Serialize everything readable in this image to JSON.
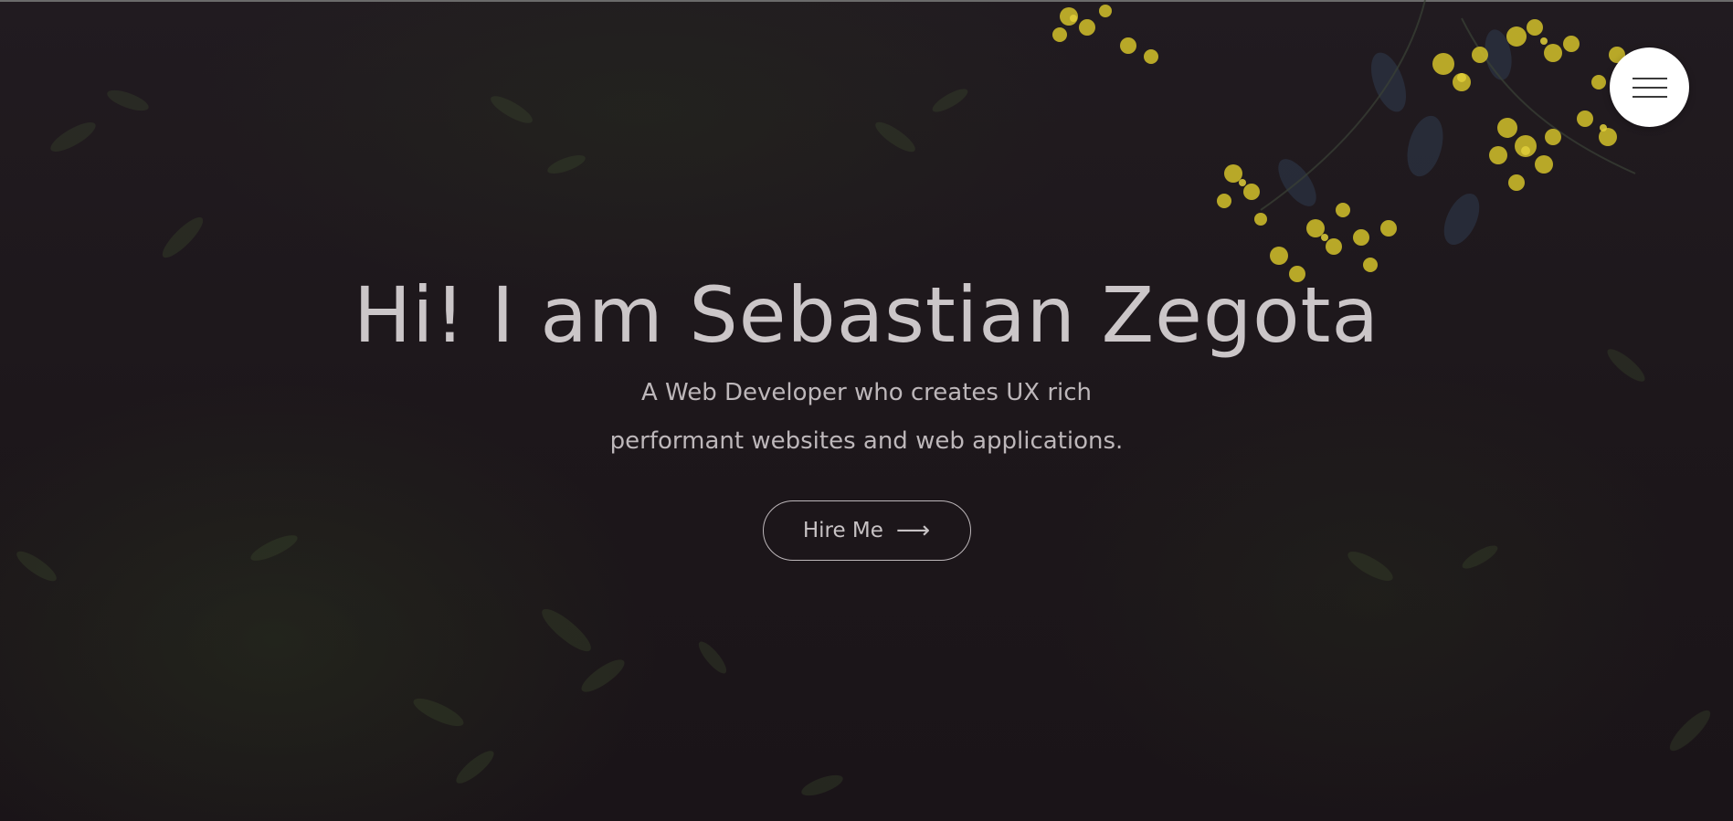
{
  "hero": {
    "title": "Hi! I am Sebastian Zegota",
    "subtitle_line1": "A Web Developer who creates UX rich",
    "subtitle_line2": "performant websites and web applications.",
    "cta_label": "Hire Me",
    "cta_icon": "arrow-right-icon"
  },
  "menu": {
    "icon": "hamburger-menu-icon"
  },
  "colors": {
    "background": "#1b1519",
    "text": "#c7c2c4",
    "menu_button": "#ffffff",
    "flowers": "#c9b82a"
  }
}
